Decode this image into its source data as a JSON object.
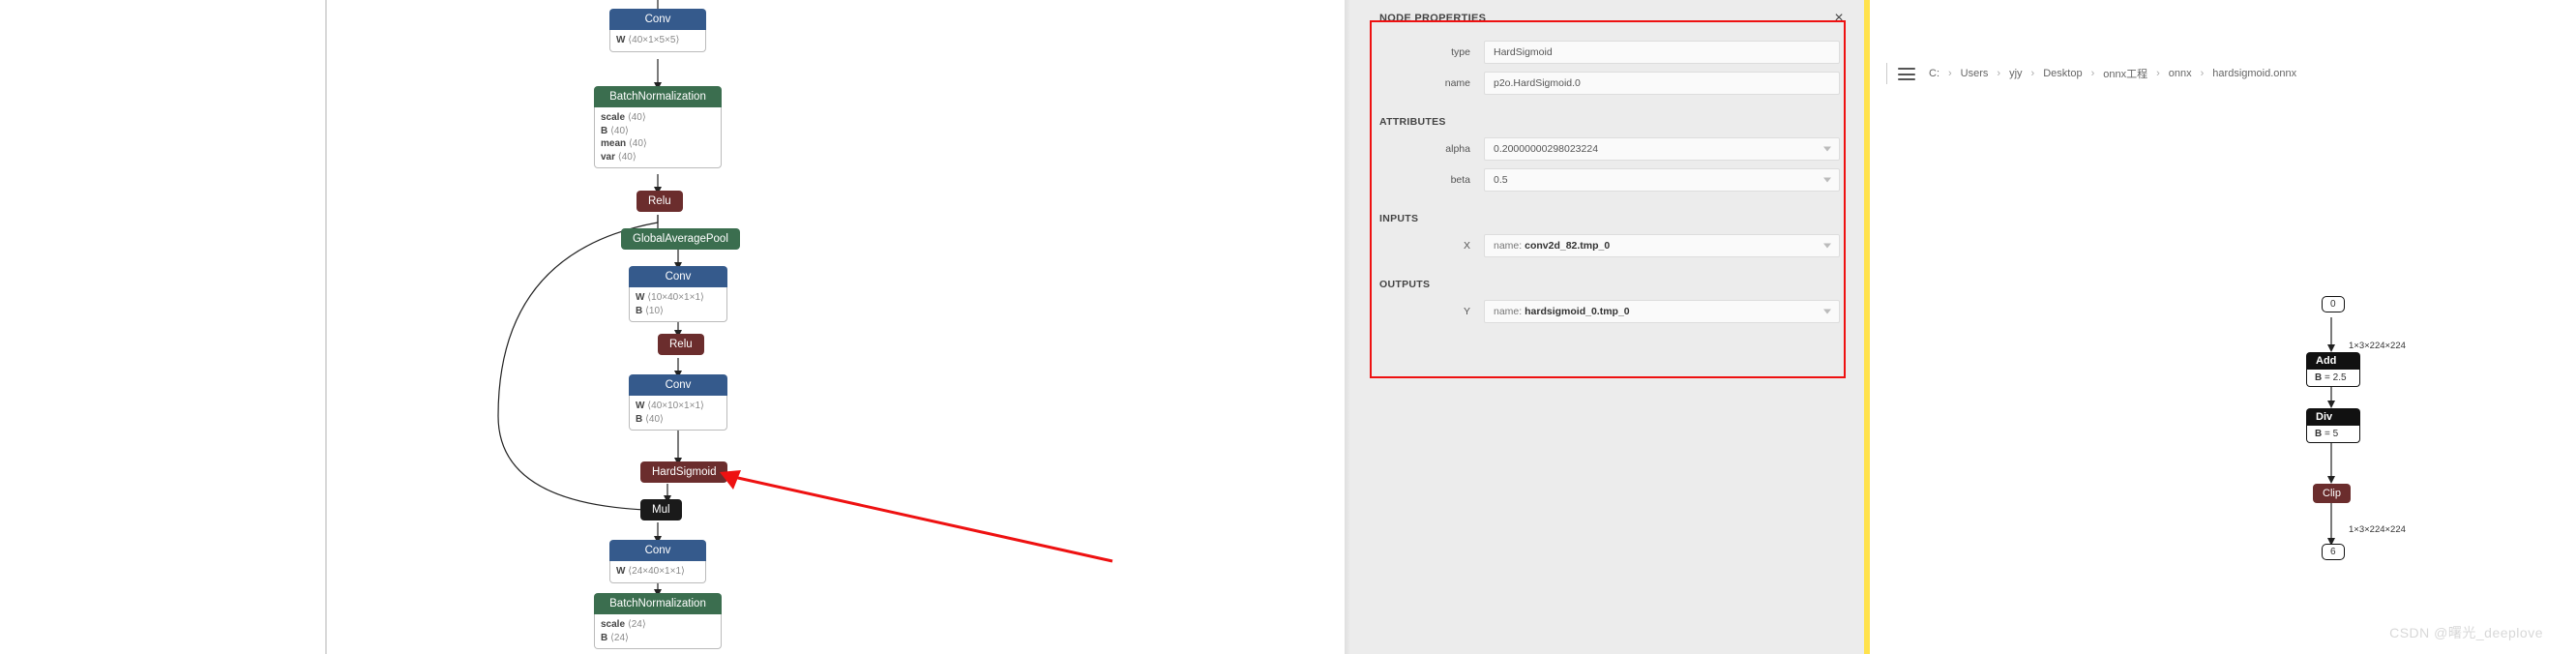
{
  "left_graph": {
    "nodes": {
      "conv1": {
        "title": "Conv",
        "attrs": [
          {
            "k": "W",
            "v": "⟨40×1×5×5⟩"
          }
        ]
      },
      "bn1": {
        "title": "BatchNormalization",
        "attrs": [
          {
            "k": "scale",
            "v": "⟨40⟩"
          },
          {
            "k": "B",
            "v": "⟨40⟩"
          },
          {
            "k": "mean",
            "v": "⟨40⟩"
          },
          {
            "k": "var",
            "v": "⟨40⟩"
          }
        ]
      },
      "relu1": {
        "title": "Relu"
      },
      "gap": {
        "title": "GlobalAveragePool"
      },
      "conv2": {
        "title": "Conv",
        "attrs": [
          {
            "k": "W",
            "v": "⟨10×40×1×1⟩"
          },
          {
            "k": "B",
            "v": "⟨10⟩"
          }
        ]
      },
      "relu2": {
        "title": "Relu"
      },
      "conv3": {
        "title": "Conv",
        "attrs": [
          {
            "k": "W",
            "v": "⟨40×10×1×1⟩"
          },
          {
            "k": "B",
            "v": "⟨40⟩"
          }
        ]
      },
      "hs": {
        "title": "HardSigmoid"
      },
      "mul": {
        "title": "Mul"
      },
      "conv4": {
        "title": "Conv",
        "attrs": [
          {
            "k": "W",
            "v": "⟨24×40×1×1⟩"
          }
        ]
      },
      "bn2": {
        "title": "BatchNormalization",
        "attrs": [
          {
            "k": "scale",
            "v": "⟨24⟩"
          },
          {
            "k": "B",
            "v": "⟨24⟩"
          }
        ]
      }
    }
  },
  "props": {
    "panel_title": "NODE PROPERTIES",
    "type_lbl": "type",
    "type_val": "HardSigmoid",
    "name_lbl": "name",
    "name_val": "p2o.HardSigmoid.0",
    "sec_attrs": "ATTRIBUTES",
    "alpha_lbl": "alpha",
    "alpha_val": "0.20000000298023224",
    "beta_lbl": "beta",
    "beta_val": "0.5",
    "sec_inputs": "INPUTS",
    "x_lbl": "X",
    "x_pre": "name: ",
    "x_val": "conv2d_82.tmp_0",
    "sec_outputs": "OUTPUTS",
    "y_lbl": "Y",
    "y_pre": "name: ",
    "y_val": "hardsigmoid_0.tmp_0"
  },
  "right": {
    "crumbs": [
      "C:",
      "Users",
      "yjy",
      "Desktop",
      "onnx工程",
      "onnx",
      "hardsigmoid.onnx"
    ],
    "io_in": "0",
    "dim_in": "1×3×224×224",
    "add": {
      "title": "Add",
      "attr_k": "B",
      "attr_v": "= 2.5"
    },
    "div": {
      "title": "Div",
      "attr_k": "B",
      "attr_v": "= 5"
    },
    "clip": {
      "title": "Clip"
    },
    "dim_out": "1×3×224×224",
    "io_out": "6"
  },
  "watermark": "CSDN @曙光_deeplove"
}
